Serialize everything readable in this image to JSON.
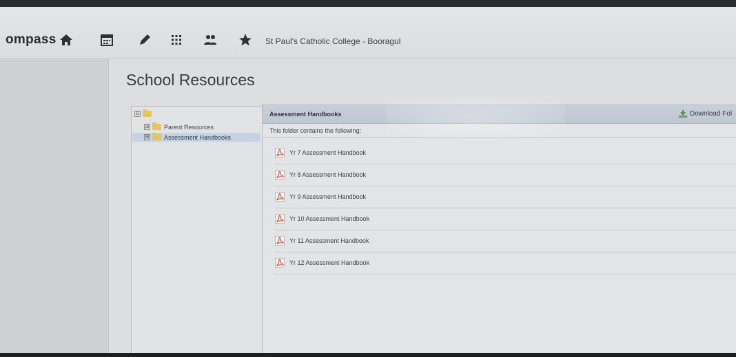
{
  "browser": {
    "tab_text": ""
  },
  "header": {
    "brand": "ompass",
    "school": "St Paul's Catholic College - Booragul",
    "nav_icons": [
      "home-icon",
      "calendar-icon",
      "pencil-icon",
      "apps-grid-icon",
      "people-icon",
      "star-icon"
    ]
  },
  "page": {
    "title": "School Resources"
  },
  "tree": {
    "root_expander": "⊟",
    "items": [
      {
        "label": "Parent Resources",
        "expander": "⊞"
      },
      {
        "label": "Assessment Handbooks",
        "expander": "⊞",
        "selected": true
      }
    ]
  },
  "files": {
    "header_title": "Assessment Handbooks",
    "download_label": "Download Fol",
    "description": "This folder contains the following:",
    "items": [
      {
        "name": "Yr 7 Assessment Handbook"
      },
      {
        "name": "Yr 8 Assessment Handbook"
      },
      {
        "name": "Yr 9 Assessment Handbook"
      },
      {
        "name": "Yr 10 Assessment Handbook"
      },
      {
        "name": "Yr 11 Assessment Handbook"
      },
      {
        "name": "Yr 12 Assessment Handbook"
      }
    ]
  },
  "colors": {
    "background": "#dddedf",
    "header_bar": "#c4ccd7",
    "selected_row": "#c7d2e3",
    "folder": "#e8c35c",
    "pdf": "#c0392b",
    "download": "#3a9a3a"
  }
}
